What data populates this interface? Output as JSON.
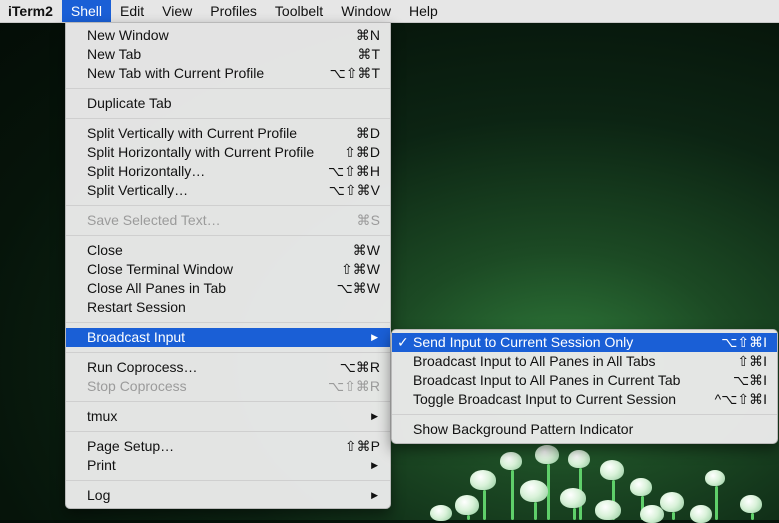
{
  "menubar": {
    "items": [
      {
        "label": "iTerm2",
        "name": "menubar-app-iterm2",
        "bold": true
      },
      {
        "label": "Shell",
        "name": "menubar-shell",
        "active": true
      },
      {
        "label": "Edit",
        "name": "menubar-edit"
      },
      {
        "label": "View",
        "name": "menubar-view"
      },
      {
        "label": "Profiles",
        "name": "menubar-profiles"
      },
      {
        "label": "Toolbelt",
        "name": "menubar-toolbelt"
      },
      {
        "label": "Window",
        "name": "menubar-window"
      },
      {
        "label": "Help",
        "name": "menubar-help"
      }
    ]
  },
  "shell_menu": {
    "groups": [
      [
        {
          "label": "New Window",
          "shortcut": "⌘N"
        },
        {
          "label": "New Tab",
          "shortcut": "⌘T"
        },
        {
          "label": "New Tab with Current Profile",
          "shortcut": "⌥⇧⌘T"
        }
      ],
      [
        {
          "label": "Duplicate Tab",
          "shortcut": ""
        }
      ],
      [
        {
          "label": "Split Vertically with Current Profile",
          "shortcut": "⌘D"
        },
        {
          "label": "Split Horizontally with Current Profile",
          "shortcut": "⇧⌘D"
        },
        {
          "label": "Split Horizontally…",
          "shortcut": "⌥⇧⌘H"
        },
        {
          "label": "Split Vertically…",
          "shortcut": "⌥⇧⌘V"
        }
      ],
      [
        {
          "label": "Save Selected Text…",
          "shortcut": "⌘S",
          "disabled": true
        }
      ],
      [
        {
          "label": "Close",
          "shortcut": "⌘W"
        },
        {
          "label": "Close Terminal Window",
          "shortcut": "⇧⌘W"
        },
        {
          "label": "Close All Panes in Tab",
          "shortcut": "⌥⌘W"
        },
        {
          "label": "Restart Session",
          "shortcut": ""
        }
      ],
      [
        {
          "label": "Broadcast Input",
          "shortcut": "",
          "submenu": true,
          "highlighted": true
        }
      ],
      [
        {
          "label": "Run Coprocess…",
          "shortcut": "⌥⌘R"
        },
        {
          "label": "Stop Coprocess",
          "shortcut": "⌥⇧⌘R",
          "disabled": true
        }
      ],
      [
        {
          "label": "tmux",
          "shortcut": "",
          "submenu": true
        }
      ],
      [
        {
          "label": "Page Setup…",
          "shortcut": "⇧⌘P"
        },
        {
          "label": "Print",
          "shortcut": "",
          "submenu": true
        }
      ],
      [
        {
          "label": "Log",
          "shortcut": "",
          "submenu": true
        }
      ]
    ]
  },
  "broadcast_submenu": {
    "groups": [
      [
        {
          "label": "Send Input to Current Session Only",
          "shortcut": "⌥⇧⌘I",
          "checked": true,
          "highlighted": true
        },
        {
          "label": "Broadcast Input to All Panes in All Tabs",
          "shortcut": "⇧⌘I"
        },
        {
          "label": "Broadcast Input to All Panes in Current Tab",
          "shortcut": "⌥⌘I"
        },
        {
          "label": "Toggle Broadcast Input to Current Session",
          "shortcut": "^⌥⇧⌘I"
        }
      ],
      [
        {
          "label": "Show Background Pattern Indicator",
          "shortcut": ""
        }
      ]
    ]
  },
  "glyphs": {
    "check": "✓",
    "submenu_arrow": "▶"
  },
  "colors": {
    "highlight": "#1a5fd6",
    "menubar_bg": "#e6e6e6",
    "disabled_text": "#9b9b9b"
  }
}
